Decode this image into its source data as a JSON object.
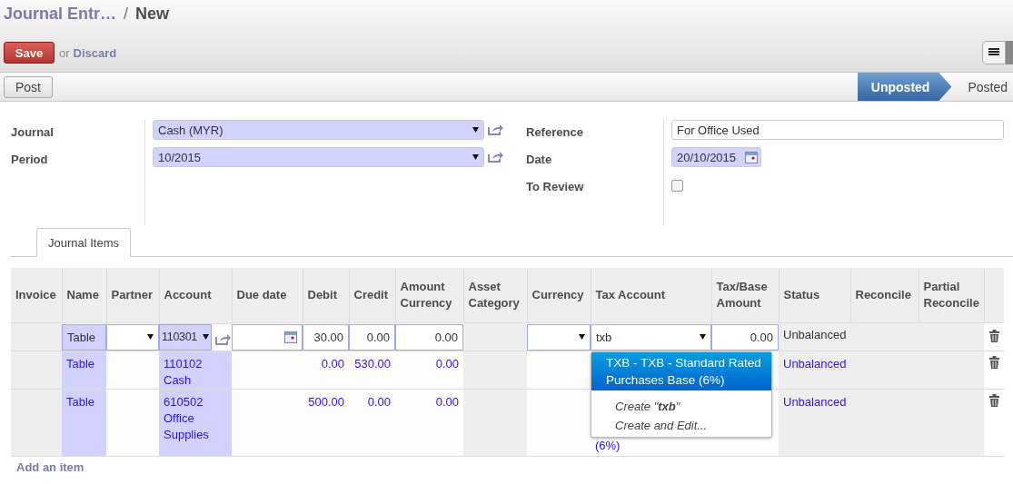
{
  "breadcrumb": {
    "parent": "Journal Entr…",
    "separator": "/",
    "current": "New"
  },
  "actions": {
    "save": "Save",
    "or": "or",
    "discard": "Discard"
  },
  "toolbar": {
    "post": "Post"
  },
  "status_bar": [
    {
      "label": "Unposted",
      "selected": true
    },
    {
      "label": "Posted",
      "selected": false
    }
  ],
  "form_left": [
    {
      "label": "Journal",
      "kind": "select",
      "value": "Cash (MYR)",
      "required": true
    },
    {
      "label": "Period",
      "kind": "select",
      "value": "10/2015",
      "required": true
    }
  ],
  "form_right": [
    {
      "label": "Reference",
      "kind": "text",
      "value": "For Office Used",
      "required": false
    },
    {
      "label": "Date",
      "kind": "date",
      "value": "20/10/2015",
      "required": true
    },
    {
      "label": "To Review",
      "kind": "checkbox",
      "checked": false
    }
  ],
  "tabs": [
    {
      "label": "Journal Items",
      "selected": true
    }
  ],
  "table": {
    "columns": [
      "Invoice",
      "Name",
      "Partner",
      "Account",
      "Due date",
      "Debit",
      "Credit",
      "Amount Currency",
      "Asset Category",
      "Currency",
      "Tax Account",
      "Tax/Base Amount",
      "Status",
      "Reconcile",
      "Partial Reconcile"
    ],
    "rows": [
      {
        "editing": true,
        "name": "Table",
        "account": "110301",
        "debit": "30.00",
        "credit": "0.00",
        "amount_currency": "0.00",
        "tax_account": "txb",
        "tax_base_amount": "0.00",
        "status": "Unbalanced"
      },
      {
        "editing": false,
        "name": "Table",
        "account": "110102 Cash",
        "debit": "0.00",
        "credit": "530.00",
        "amount_currency": "0.00",
        "status": "Unbalanced"
      },
      {
        "editing": false,
        "name": "Table",
        "account": "610502 Office Supplies",
        "debit": "500.00",
        "credit": "0.00",
        "amount_currency": "0.00",
        "tax_account": "(6%)",
        "status": "Unbalanced"
      }
    ],
    "add_item": "Add an item"
  },
  "autocomplete": {
    "options": [
      {
        "label": "TXB - TXB - Standard Rated Purchases Base (6%)",
        "selected": true
      }
    ],
    "create": "Create \"**txb**\"",
    "create_and_edit": "Create and Edit..."
  }
}
